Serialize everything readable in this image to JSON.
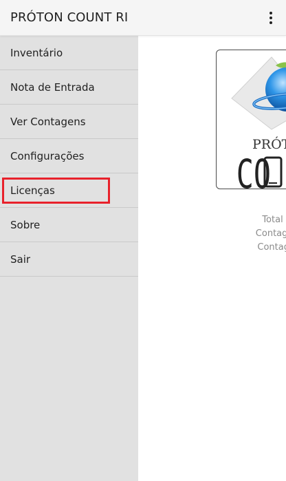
{
  "app": {
    "title": "PRÓTON COUNT RI"
  },
  "toolbar": {
    "overflow_icon": "more-vertical-icon"
  },
  "drawer": {
    "items": [
      {
        "label": "Inventário"
      },
      {
        "label": "Nota de Entrada"
      },
      {
        "label": "Ver Contagens"
      },
      {
        "label": "Configurações"
      },
      {
        "label": "Licenças",
        "highlighted": true
      },
      {
        "label": "Sobre"
      },
      {
        "label": "Sair"
      }
    ]
  },
  "main": {
    "logo": {
      "brand_top": "PRÓT",
      "brand_bottom": "CO",
      "icon": "globe-logo-icon"
    },
    "stats": [
      {
        "text": "Total de cor"
      },
      {
        "text": "Contagens em"
      },
      {
        "text": "Contagens ex"
      }
    ]
  },
  "colors": {
    "header_bg": "#f5f5f5",
    "drawer_bg": "#e1e1e1",
    "divider": "#c9c9c9",
    "highlight": "#e8212b",
    "text_primary": "#212121",
    "text_secondary": "#8a8a8a",
    "globe_blue": "#1e88e5"
  }
}
